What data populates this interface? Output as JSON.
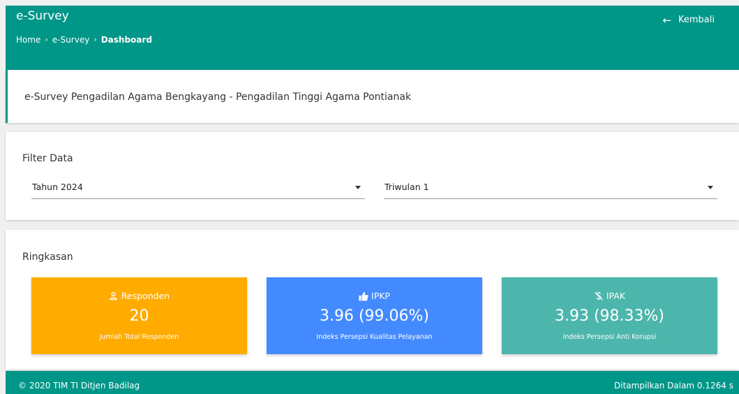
{
  "header": {
    "app_title": "e-Survey",
    "breadcrumb": [
      "Home",
      "e-Survey",
      "Dashboard"
    ],
    "back_label": "Kembali",
    "back_icon": "arrow-left-icon",
    "bg_color": "#009688"
  },
  "title_card": {
    "text": "e-Survey Pengadilan Agama Bengkayang - Pengadilan Tinggi Agama Pontianak"
  },
  "filter": {
    "heading": "Filter Data",
    "year_select": "Tahun 2024",
    "quarter_select": "Triwulan 1"
  },
  "summary": {
    "heading": "Ringkasan",
    "stats": [
      {
        "label": "Responden",
        "value": "20",
        "caption": "Jumlah Total Responden",
        "icon": "user-icon",
        "color": "#ffab00"
      },
      {
        "label": "IPKP",
        "value": "3.96 (99.06%)",
        "caption": "Indeks Persepsi Kualitas Pelayanan",
        "icon": "thumbs-up-icon",
        "color": "#448aff"
      },
      {
        "label": "IPAK",
        "value": "3.93 (98.33%)",
        "caption": "Indeks Persepsi Anti Korupsi",
        "icon": "no-money-icon",
        "color": "#4db6ac"
      }
    ]
  },
  "footer": {
    "copyright": "© 2020 TIM TI Ditjen Badilag",
    "timing": "Ditampilkan Dalam 0.1264 s"
  }
}
